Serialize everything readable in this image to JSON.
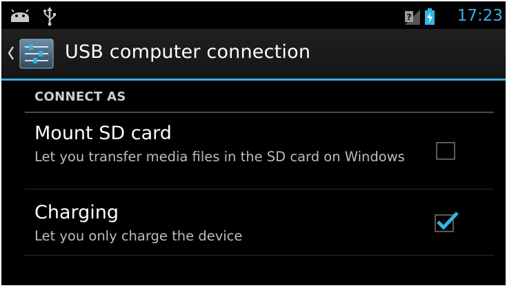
{
  "status_bar": {
    "time": "17:23",
    "icons": [
      "android-debug-icon",
      "usb-icon",
      "no-sim-signal-icon",
      "battery-charging-icon"
    ],
    "accent_color": "#33b5e5"
  },
  "action_bar": {
    "title": "USB computer connection",
    "up_icon": "chevron-left-icon",
    "app_icon": "settings-icon"
  },
  "section": {
    "header": "CONNECT AS"
  },
  "options": [
    {
      "title": "Mount SD card",
      "summary": "Let you transfer media files in the SD card on Windows",
      "checked": false
    },
    {
      "title": "Charging",
      "summary": "Let you only charge the device",
      "checked": true
    }
  ]
}
